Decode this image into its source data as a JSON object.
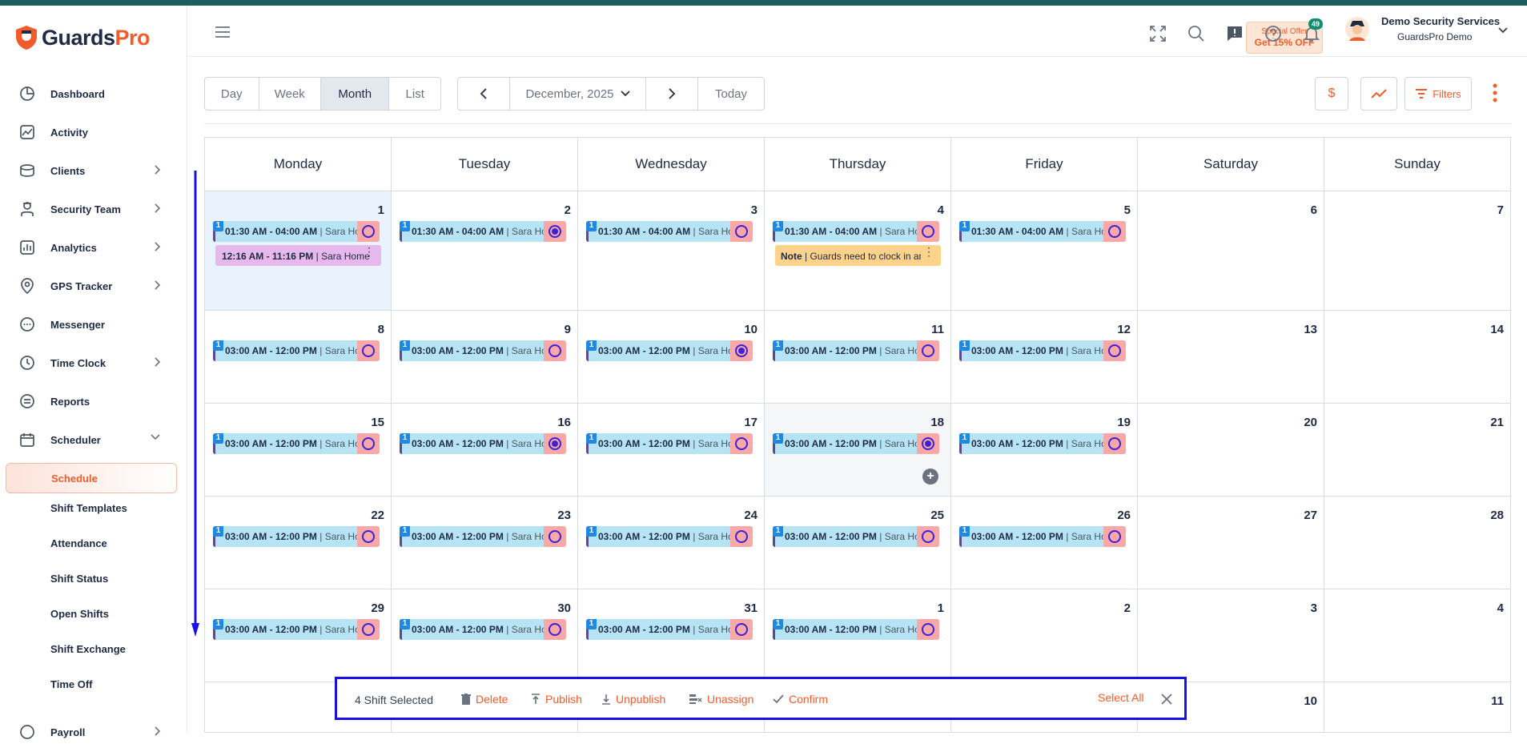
{
  "brand": {
    "name_part1": "Guards",
    "name_part2": "Pro"
  },
  "sidebar": {
    "items": [
      {
        "label": "Dashboard",
        "icon": "pie-chart-icon"
      },
      {
        "label": "Activity",
        "icon": "activity-icon"
      },
      {
        "label": "Clients",
        "icon": "clients-icon"
      },
      {
        "label": "Security Team",
        "icon": "security-team-icon"
      },
      {
        "label": "Analytics",
        "icon": "analytics-icon"
      },
      {
        "label": "GPS Tracker",
        "icon": "map-pin-icon"
      },
      {
        "label": "Messenger",
        "icon": "chat-icon"
      },
      {
        "label": "Time Clock",
        "icon": "clock-icon"
      },
      {
        "label": "Reports",
        "icon": "report-icon"
      },
      {
        "label": "Scheduler",
        "icon": "calendar-icon"
      }
    ],
    "scheduler_sub": [
      "Schedule",
      "Shift Templates",
      "Attendance",
      "Shift Status",
      "Open Shifts",
      "Shift Exchange",
      "Time Off"
    ],
    "payroll": "Payroll"
  },
  "header": {
    "offer_line1": "Special Offer",
    "offer_line2": "Get 15% OFF",
    "notification_count": "49",
    "user_name": "Demo Security Services",
    "user_org": "GuardsPro Demo"
  },
  "toolbar": {
    "views": [
      "Day",
      "Week",
      "Month",
      "List"
    ],
    "active_view": "Month",
    "period": "December, 2025",
    "today": "Today",
    "filters": "Filters"
  },
  "calendar": {
    "weekdays": [
      "Monday",
      "Tuesday",
      "Wednesday",
      "Thursday",
      "Friday",
      "Saturday",
      "Sunday"
    ],
    "weeks": [
      [
        "1",
        "2",
        "3",
        "4",
        "5",
        "6",
        "7"
      ],
      [
        "8",
        "9",
        "10",
        "11",
        "12",
        "13",
        "14"
      ],
      [
        "15",
        "16",
        "17",
        "18",
        "19",
        "20",
        "21"
      ],
      [
        "22",
        "23",
        "24",
        "25",
        "26",
        "27",
        "28"
      ],
      [
        "29",
        "30",
        "31",
        "1",
        "2",
        "3",
        "4"
      ],
      [
        "",
        "",
        "",
        "",
        "",
        "10",
        "11"
      ]
    ],
    "shift_badge": "1",
    "shift_time_week1": "01:30 AM - 04:00 AM",
    "shift_time": "03:00 AM - 12:00 PM",
    "shift_person": " | Sara Home",
    "extra_shift": "12:16 AM - 11:16 PM",
    "extra_person": " | Sara Home",
    "note_label": "Note",
    "note_text": " | Guards need to clock in and out"
  },
  "action_bar": {
    "count": "4 Shift Selected",
    "delete": "Delete",
    "publish": "Publish",
    "unpublish": "Unpublish",
    "unassign": "Unassign",
    "confirm": "Confirm",
    "select_all": "Select All"
  }
}
